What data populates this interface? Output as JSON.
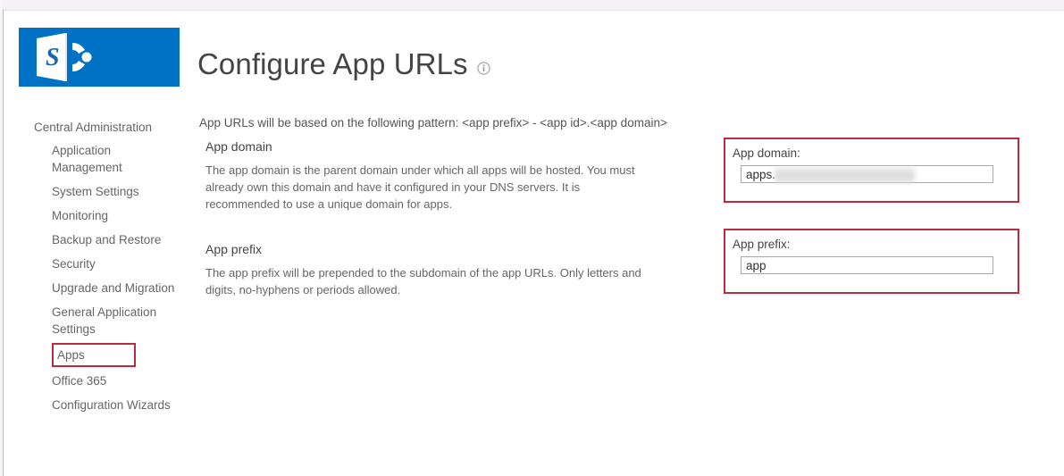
{
  "window": {
    "title": "Configure App URLs"
  },
  "branding": {
    "logo_name": "sharepoint-logo",
    "logo_letter": "S",
    "logo_color": "#0072c6"
  },
  "header": {
    "title": "Configure App URLs",
    "info_icon": "info-icon"
  },
  "sidebar": {
    "header": "Central Administration",
    "items": [
      {
        "label": "Application Management",
        "flagged": false
      },
      {
        "label": "System Settings",
        "flagged": false
      },
      {
        "label": "Monitoring",
        "flagged": false
      },
      {
        "label": "Backup and Restore",
        "flagged": false
      },
      {
        "label": "Security",
        "flagged": false
      },
      {
        "label": "Upgrade and Migration",
        "flagged": false
      },
      {
        "label": "General Application Settings",
        "flagged": false
      },
      {
        "label": "Apps",
        "flagged": true
      },
      {
        "label": "Office 365",
        "flagged": false
      },
      {
        "label": "Configuration Wizards",
        "flagged": false
      }
    ]
  },
  "content": {
    "pattern_line": "App URLs will be based on the following pattern: <app prefix> - <app id>.<app domain>",
    "sections": [
      {
        "title": "App domain",
        "body": "The app domain is the parent domain under which all apps will be hosted. You must already own this domain and have it configured in your DNS servers. It is recommended to use a unique domain for apps."
      },
      {
        "title": "App prefix",
        "body": "The app prefix will be prepended to the subdomain of the app URLs. Only letters and digits, no-hyphens or periods allowed."
      }
    ]
  },
  "form": {
    "app_domain": {
      "label": "App domain:",
      "value": "apps.",
      "redacted": true
    },
    "app_prefix": {
      "label": "App prefix:",
      "value": "app",
      "redacted": false
    }
  },
  "annotation": {
    "color": "#bb2b40"
  }
}
